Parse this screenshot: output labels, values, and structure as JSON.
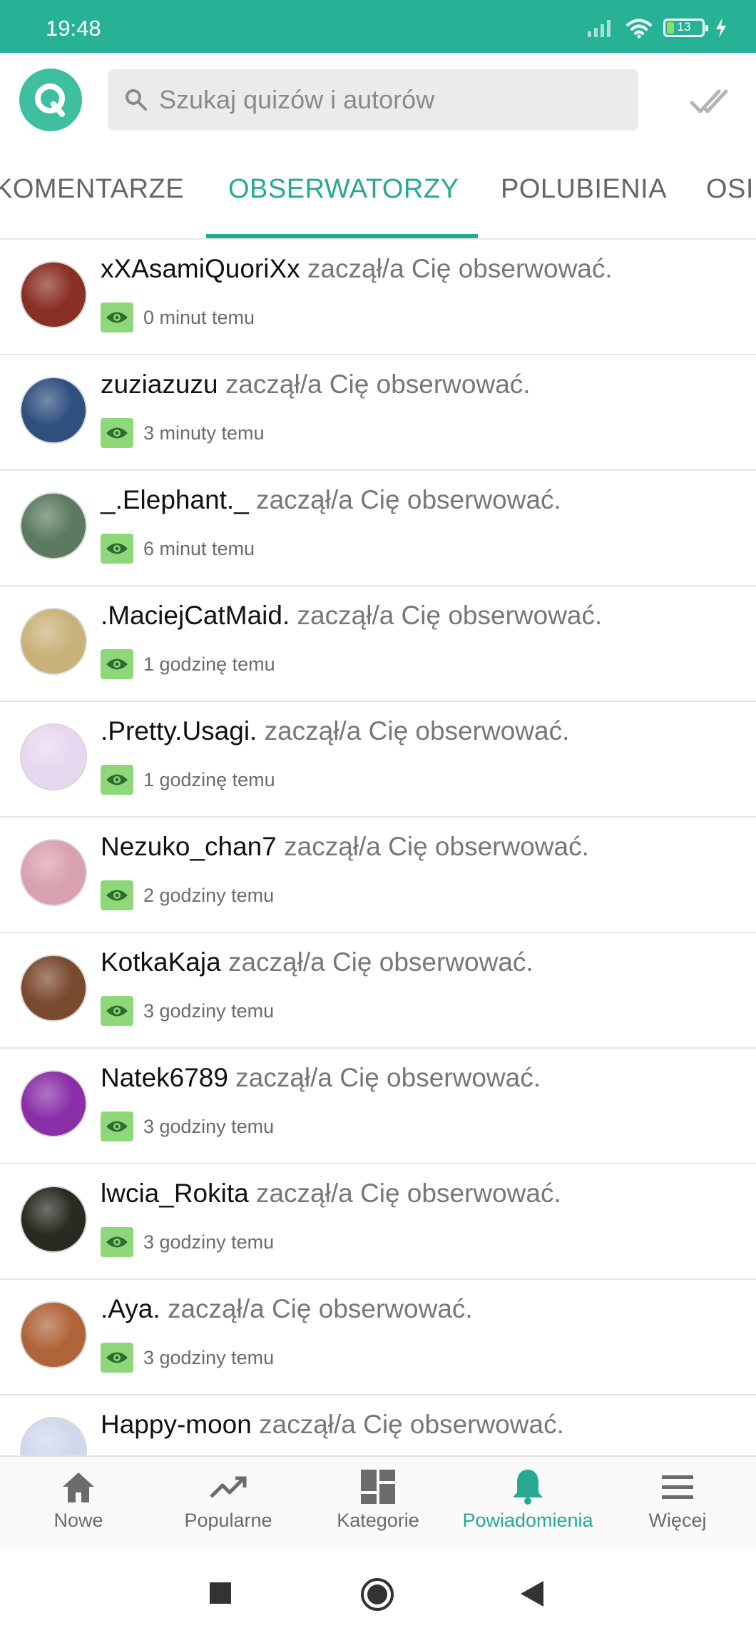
{
  "status_bar": {
    "time": "19:48",
    "battery_level": "13",
    "background_color": "#27b295"
  },
  "header": {
    "logo_letter": "Q",
    "search_placeholder": "Szukaj quizów i autorów",
    "accent_color": "#27a991"
  },
  "tabs": [
    {
      "label": "KOMENTARZE",
      "active": false
    },
    {
      "label": "OBSERWATORZY",
      "active": true
    },
    {
      "label": "POLUBIENIA",
      "active": false
    },
    {
      "label": "OSI",
      "active": false
    }
  ],
  "notifications": [
    {
      "username": "xXAsamiQuoriXx",
      "action": "zaczął/a Cię obserwować.",
      "time": "0 minut temu",
      "avatar_color": "#8a2f23"
    },
    {
      "username": "zuziazuzu",
      "action": "zaczął/a Cię obserwować.",
      "time": "3 minuty temu",
      "avatar_color": "#2f4f7f"
    },
    {
      "username": "_.Elephant._",
      "action": "zaczął/a Cię obserwować.",
      "time": "6 minut temu",
      "avatar_color": "#5c7a5f"
    },
    {
      "username": ".MaciejCatMaid.",
      "action": "zaczął/a Cię obserwować.",
      "time": "1 godzinę temu",
      "avatar_color": "#c9b27a"
    },
    {
      "username": ".Pretty.Usagi.",
      "action": "zaczął/a Cię obserwować.",
      "time": "1 godzinę temu",
      "avatar_color": "#e7d7ef"
    },
    {
      "username": "Nezuko_chan7",
      "action": "zaczął/a Cię obserwować.",
      "time": "2 godziny temu",
      "avatar_color": "#d9a1b0"
    },
    {
      "username": "KotkaKaja",
      "action": "zaczął/a Cię obserwować.",
      "time": "3 godziny temu",
      "avatar_color": "#7a4a2e"
    },
    {
      "username": "Natek6789",
      "action": "zaczął/a Cię obserwować.",
      "time": "3 godziny temu",
      "avatar_color": "#8a2fa8"
    },
    {
      "username": "lwcia_Rokita",
      "action": "zaczął/a Cię obserwować.",
      "time": "3 godziny temu",
      "avatar_color": "#2a2a22"
    },
    {
      "username": ".Aya.",
      "action": "zaczął/a Cię obserwować.",
      "time": "3 godziny temu",
      "avatar_color": "#b0643a"
    },
    {
      "username": "Happy-moon",
      "action": "zaczął/a Cię obserwować.",
      "time": "",
      "avatar_color": "#cfd8ec"
    }
  ],
  "bottom_nav": [
    {
      "label": "Nowe",
      "icon": "home-icon",
      "active": false
    },
    {
      "label": "Popularne",
      "icon": "trending-icon",
      "active": false
    },
    {
      "label": "Kategorie",
      "icon": "grid-icon",
      "active": false
    },
    {
      "label": "Powiadomienia",
      "icon": "bell-icon",
      "active": true
    },
    {
      "label": "Więcej",
      "icon": "menu-icon",
      "active": false
    }
  ],
  "system_nav": {
    "icons": [
      "square-icon",
      "circle-icon",
      "back-triangle-icon"
    ]
  }
}
